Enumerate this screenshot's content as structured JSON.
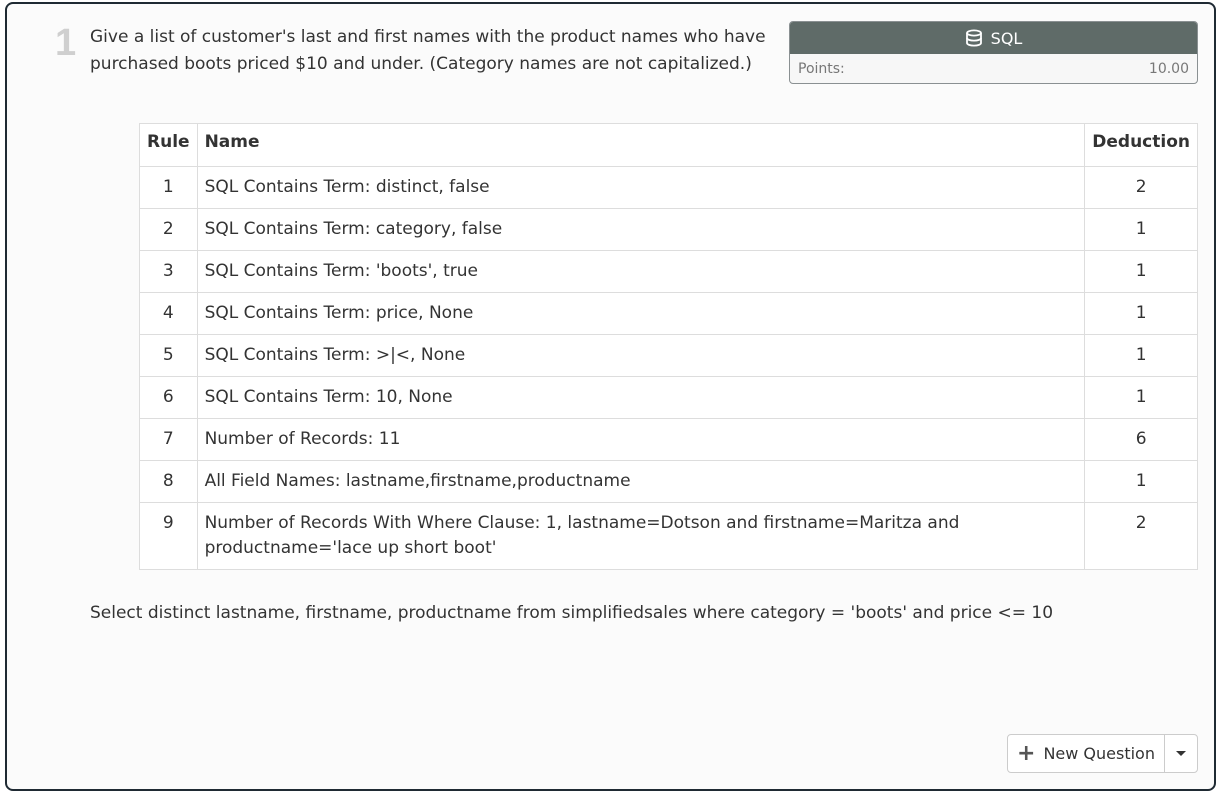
{
  "question": {
    "number": "1",
    "text": "Give a list of customer's last and first names with the product names who have purchased boots priced $10 and under. (Category names are not capitalized.)"
  },
  "sql_box": {
    "icon": "database-icon",
    "label": "SQL",
    "points_label": "Points:",
    "points_value": "10.00"
  },
  "rules_table": {
    "headers": {
      "rule": "Rule",
      "name": "Name",
      "deduction": "Deduction"
    },
    "rows": [
      {
        "rule": "1",
        "name": "SQL Contains Term: distinct, false",
        "deduction": "2"
      },
      {
        "rule": "2",
        "name": "SQL Contains Term: category, false",
        "deduction": "1"
      },
      {
        "rule": "3",
        "name": "SQL Contains Term: 'boots', true",
        "deduction": "1"
      },
      {
        "rule": "4",
        "name": "SQL Contains Term: price, None",
        "deduction": "1"
      },
      {
        "rule": "5",
        "name": "SQL Contains Term: >|<, None",
        "deduction": "1"
      },
      {
        "rule": "6",
        "name": "SQL Contains Term: 10, None",
        "deduction": "1"
      },
      {
        "rule": "7",
        "name": "Number of Records: 11",
        "deduction": "6"
      },
      {
        "rule": "8",
        "name": "All Field Names: lastname,firstname,productname",
        "deduction": "1"
      },
      {
        "rule": "9",
        "name": "Number of Records With Where Clause: 1, lastname=Dotson and firstname=Maritza and productname='lace up short boot'",
        "deduction": "2"
      }
    ]
  },
  "answer_sql": "Select distinct lastname, firstname, productname from simplifiedsales where category = 'boots' and price <= 10",
  "new_question_button": {
    "icon": "plus-icon",
    "label": "New Question"
  },
  "colors": {
    "sql_header": "#5f6b68",
    "frame_border": "#1f2a33"
  }
}
